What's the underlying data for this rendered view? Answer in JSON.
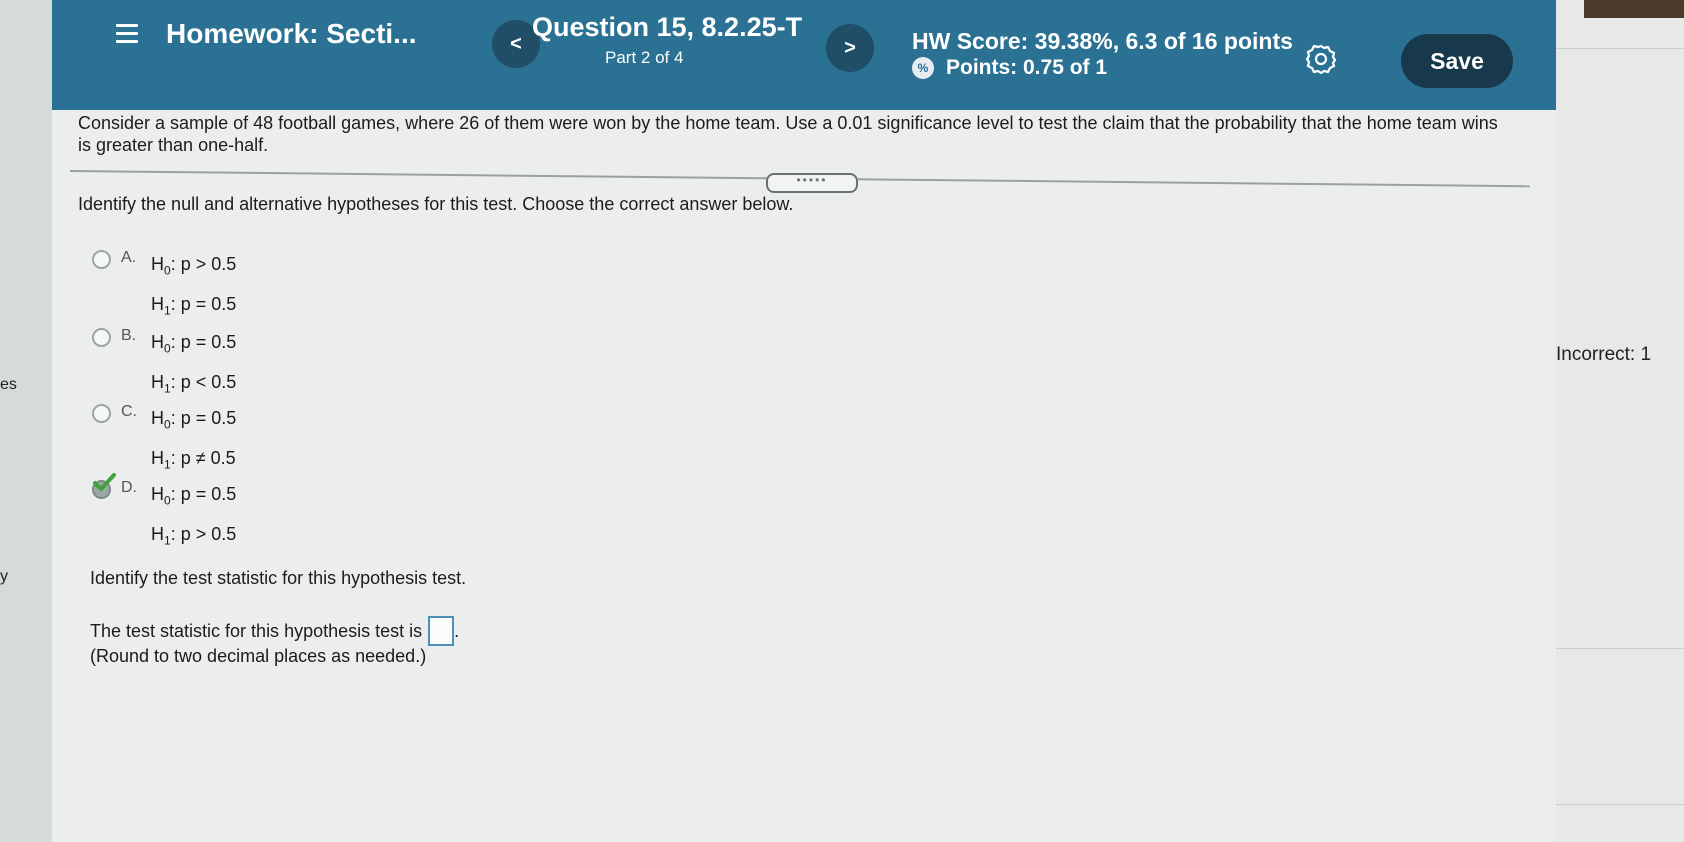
{
  "header": {
    "title": "Homework: Secti...",
    "question": "Question 15, 8.2.25-T",
    "part": "Part 2 of 4",
    "hw_score": "HW Score: 39.38%, 6.3 of 16 points",
    "points": "Points: 0.75 of 1",
    "save_label": "Save",
    "prev_label": "<",
    "next_label": ">"
  },
  "prompt": "Consider a sample of 48 football games, where 26 of them were won by the home team. Use a 0.01 significance level to test the claim that the probability that the home team wins is greater than one-half.",
  "instruction": "Identify the null and alternative hypotheses for this test. Choose the correct answer below.",
  "choices": [
    {
      "letter": "A.",
      "h0": "p > 0.5",
      "h1": "p = 0.5"
    },
    {
      "letter": "B.",
      "h0": "p = 0.5",
      "h1": "p < 0.5"
    },
    {
      "letter": "C.",
      "h0": "p = 0.5",
      "h1": "p ≠ 0.5"
    },
    {
      "letter": "D.",
      "h0": "p = 0.5",
      "h1": "p > 0.5"
    }
  ],
  "selected_choice": "D",
  "test_stat_question": "Identify the test statistic for this hypothesis test.",
  "test_stat_line": "The test statistic for this hypothesis test is",
  "test_stat_value": "",
  "round_note": "(Round to two decimal places as needed.)",
  "side": {
    "incorrect": "Incorrect: 1",
    "paren": ")",
    "paren2": "1)",
    "left_es": "es",
    "left_y": "y"
  },
  "colors": {
    "header": "#2a7193",
    "save": "#17394b",
    "check": "#3fa33a"
  }
}
